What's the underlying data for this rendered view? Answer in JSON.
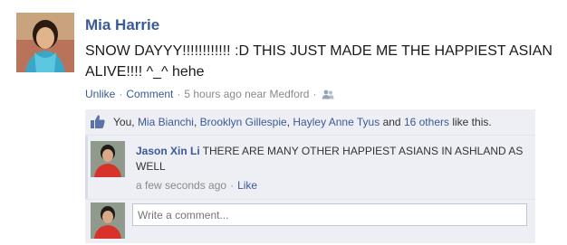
{
  "post": {
    "author": "Mia Harrie",
    "text": "SNOW DAYYY!!!!!!!!!!!! :D THIS JUST MADE ME THE HAPPIEST ASIAN ALIVE!!!! ^_^ hehe",
    "actions": {
      "unlike": "Unlike",
      "comment": "Comment",
      "timestamp": "5 hours ago",
      "location": "near Medford",
      "separator": "·",
      "audience_icon": "people-icon"
    }
  },
  "likes": {
    "icon": "thumbs-up-icon",
    "you": "You,",
    "names": [
      "Mia Bianchi",
      "Brooklyn Gillespie",
      "Hayley Anne Tyus"
    ],
    "name_separator": ",",
    "and": "and",
    "others": "16 others",
    "suffix": "like this."
  },
  "comments": [
    {
      "author": "Jason Xin Li",
      "text": "THERE ARE MANY OTHER HAPPIEST ASIANS IN ASHLAND AS WELL",
      "time": "a few seconds ago",
      "separator": "·",
      "like": "Like"
    }
  ],
  "compose": {
    "placeholder": "Write a comment..."
  },
  "colors": {
    "link": "#3b5998",
    "ufi_background": "#edeff4",
    "meta_text": "#8a8a8a"
  }
}
